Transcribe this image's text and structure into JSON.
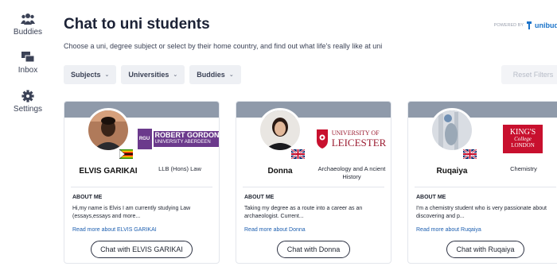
{
  "sidebar": {
    "items": [
      {
        "label": "Buddies",
        "icon": "people-icon"
      },
      {
        "label": "Inbox",
        "icon": "inbox-icon"
      },
      {
        "label": "Settings",
        "icon": "gear-icon"
      }
    ]
  },
  "header": {
    "title": "Chat to uni students",
    "subtitle": "Choose a uni, degree subject or select by their home country, and find out what life's really like at uni",
    "powered_by": "POWERED BY",
    "powered_brand": "unibud"
  },
  "filters": {
    "subjects": "Subjects",
    "universities": "Universities",
    "buddies": "Buddies",
    "reset": "Reset Filters"
  },
  "cards": [
    {
      "name": "ELVIS GARIKAI",
      "flag": "zimbabwe",
      "university_logo": [
        "ROBERT GORDON",
        "UNIVERSITY ABERDEEN",
        "RGU"
      ],
      "degree": "LLB (Hons) Law",
      "about_heading": "ABOUT ME",
      "about_text": "Hi,my name is Elvis I am currently studying Law (essays,essays and more...",
      "read_more": "Read more about ELVIS GARIKAI",
      "chat_label": "Chat with ELVIS GARIKAI"
    },
    {
      "name": "Donna",
      "flag": "uk",
      "university_logo": [
        "UNIVERSITY OF",
        "LEICESTER"
      ],
      "degree": "Archaeology and A ncient History",
      "about_heading": "ABOUT ME",
      "about_text": "Taking my degree as a route into a career as an archaeologist. Current...",
      "read_more": "Read more about Donna",
      "chat_label": "Chat with Donna"
    },
    {
      "name": "Ruqaiya",
      "flag": "uk",
      "university_logo": [
        "KING'S",
        "College",
        "LONDON"
      ],
      "degree": "Chemistry",
      "about_heading": "ABOUT ME",
      "about_text": "I'm a chemistry student who is very passionate about discovering and p...",
      "read_more": "Read more about Ruqaiya",
      "chat_label": "Chat with Ruqaiya"
    }
  ],
  "colors": {
    "card_band": "#8f9aaa",
    "link": "#1d5fb0",
    "brand": "#1a73c9",
    "kings_red": "#c8102e"
  }
}
